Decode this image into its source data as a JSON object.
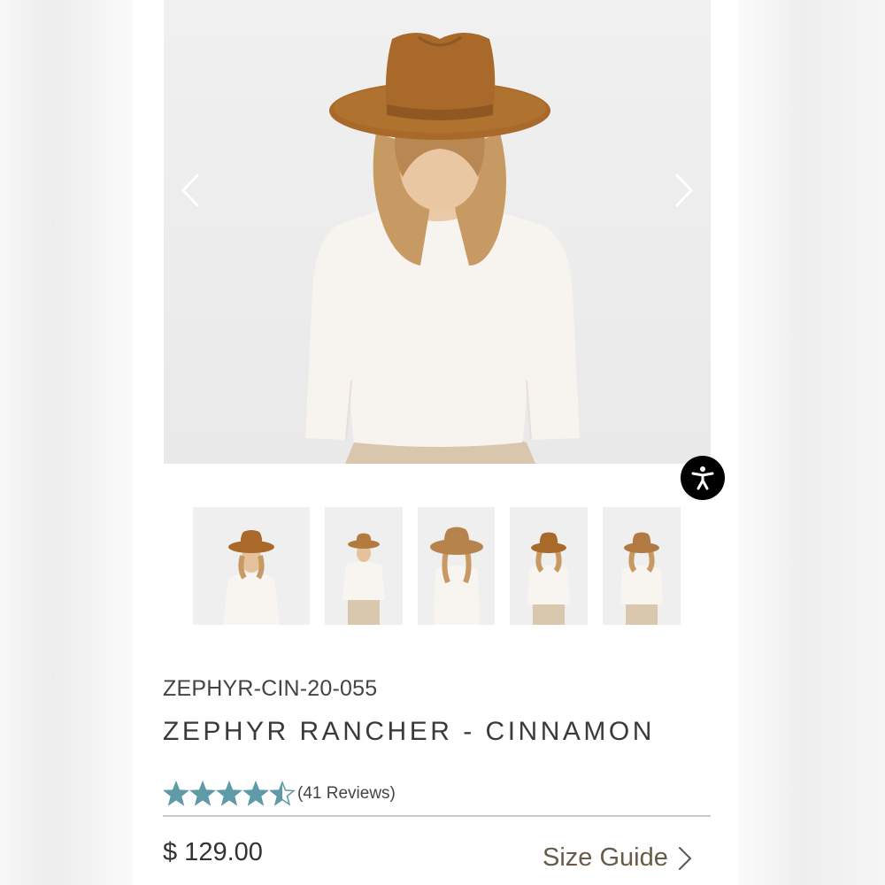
{
  "product": {
    "sku": "ZEPHYR-CIN-20-055",
    "title": "ZEPHYR RANCHER - CINNAMON",
    "rating": 4.5,
    "rating_max": 5,
    "reviews_label": "(41 Reviews)",
    "price": "$ 129.00",
    "size_guide_label": "Size Guide"
  },
  "gallery": {
    "prev_icon": "chevron-left-icon",
    "next_icon": "chevron-right-icon",
    "thumbnail_count": 5
  },
  "accessibility": {
    "icon": "accessibility-icon"
  },
  "colors": {
    "hat": "#a8692a",
    "star": "#5f9aa8",
    "size_guide": "#6a5a48",
    "a11y_bg": "#000000"
  }
}
